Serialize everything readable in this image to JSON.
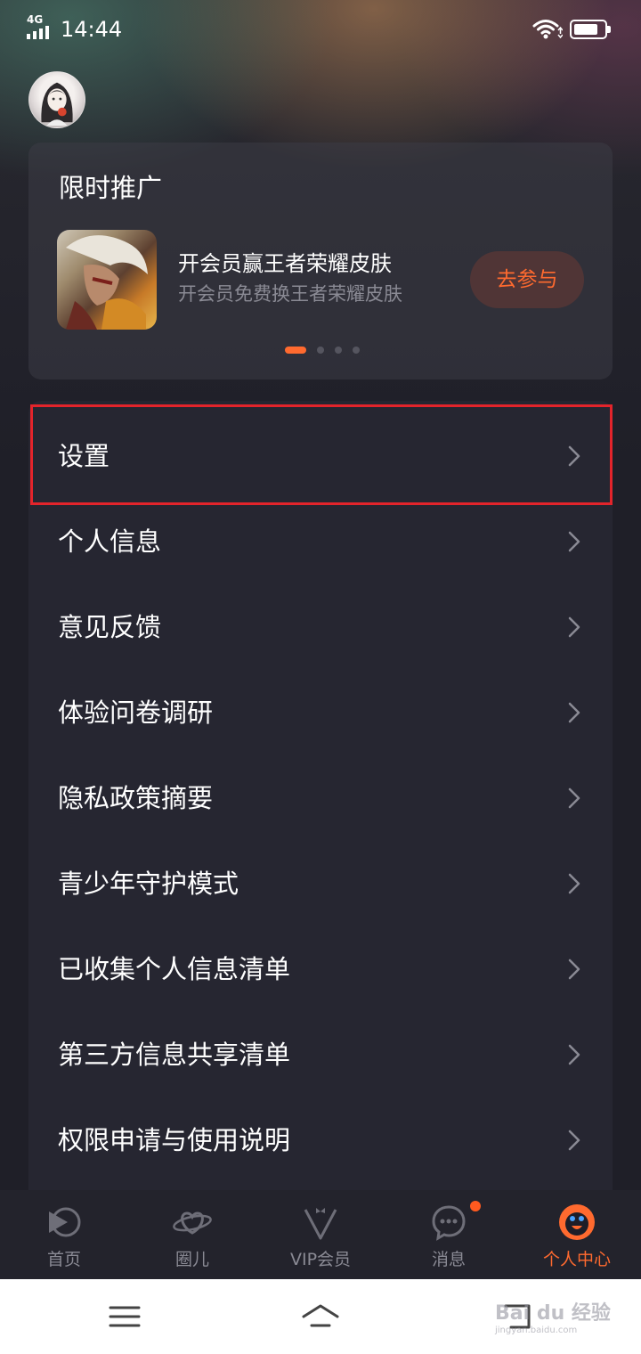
{
  "status_bar": {
    "network": "4G",
    "time": "14:44"
  },
  "promo": {
    "title": "限时推广",
    "name": "开会员赢王者荣耀皮肤",
    "desc": "开会员免费换王者荣耀皮肤",
    "button": "去参与",
    "carousel_count": 4,
    "carousel_active": 0
  },
  "menu": {
    "items": [
      {
        "label": "设置"
      },
      {
        "label": "个人信息"
      },
      {
        "label": "意见反馈"
      },
      {
        "label": "体验问卷调研"
      },
      {
        "label": "隐私政策摘要"
      },
      {
        "label": "青少年守护模式"
      },
      {
        "label": "已收集个人信息清单"
      },
      {
        "label": "第三方信息共享清单"
      },
      {
        "label": "权限申请与使用说明"
      }
    ]
  },
  "tabs": [
    {
      "label": "首页",
      "icon": "play-icon"
    },
    {
      "label": "圈儿",
      "icon": "planet-icon"
    },
    {
      "label": "VIP会员",
      "icon": "vip-icon"
    },
    {
      "label": "消息",
      "icon": "message-icon"
    },
    {
      "label": "个人中心",
      "icon": "profile-face-icon"
    }
  ],
  "colors": {
    "accent": "#ff6a2f",
    "highlight": "#e3242b",
    "card": "#262631"
  },
  "watermark": {
    "text": "Bai du 经验",
    "sub": "jingyan.baidu.com"
  }
}
